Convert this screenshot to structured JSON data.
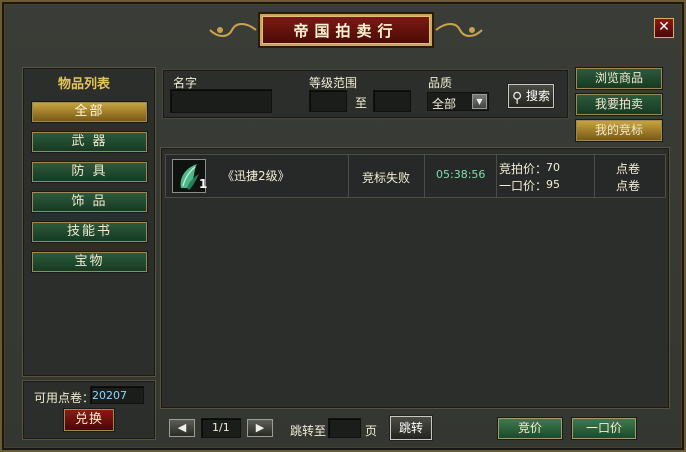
{
  "window": {
    "title": "帝国拍卖行",
    "close_glyph": "✕"
  },
  "sidebar": {
    "heading": "物品列表",
    "items": [
      {
        "label": "全部",
        "active": true
      },
      {
        "label": "武 器",
        "active": false
      },
      {
        "label": "防 具",
        "active": false
      },
      {
        "label": "饰 品",
        "active": false
      },
      {
        "label": "技能书",
        "active": false
      },
      {
        "label": "宝物",
        "active": false
      }
    ],
    "points_label": "可用点卷：",
    "points_value": "20207",
    "exchange_label": "兑换"
  },
  "filters": {
    "name_label": "名字",
    "name_value": "",
    "level_label": "等级范围",
    "level_to_label": "至",
    "level_from": "",
    "level_to": "",
    "quality_label": "品质",
    "quality_value": "全部",
    "search_label": "搜索"
  },
  "right_tabs": [
    {
      "label": "浏览商品",
      "active": false
    },
    {
      "label": "我要拍卖",
      "active": false
    },
    {
      "label": "我的竞标",
      "active": true
    }
  ],
  "listing": {
    "rows": [
      {
        "quantity": "1",
        "name": "《迅捷2级》",
        "status": "竞标失败",
        "time_left": "05:38:56",
        "bid_label": "竞拍价：",
        "bid_value": "70",
        "buyout_label": "一口价：",
        "buyout_value": "95",
        "currency_1": "点卷",
        "currency_2": "点卷"
      }
    ]
  },
  "pager": {
    "prev": "◀",
    "next": "▶",
    "page": "1/1",
    "jump_label": "跳转至",
    "page_suffix": "页",
    "jump_value": "",
    "jump_btn": "跳转"
  },
  "actions": {
    "bid": "竞价",
    "buyout": "一口价"
  },
  "colors": {
    "accent_gold": "#c7a33f",
    "button_green": "#2c5a3c",
    "time_green": "#7fe0a8",
    "title_red": "#7a1a12"
  }
}
